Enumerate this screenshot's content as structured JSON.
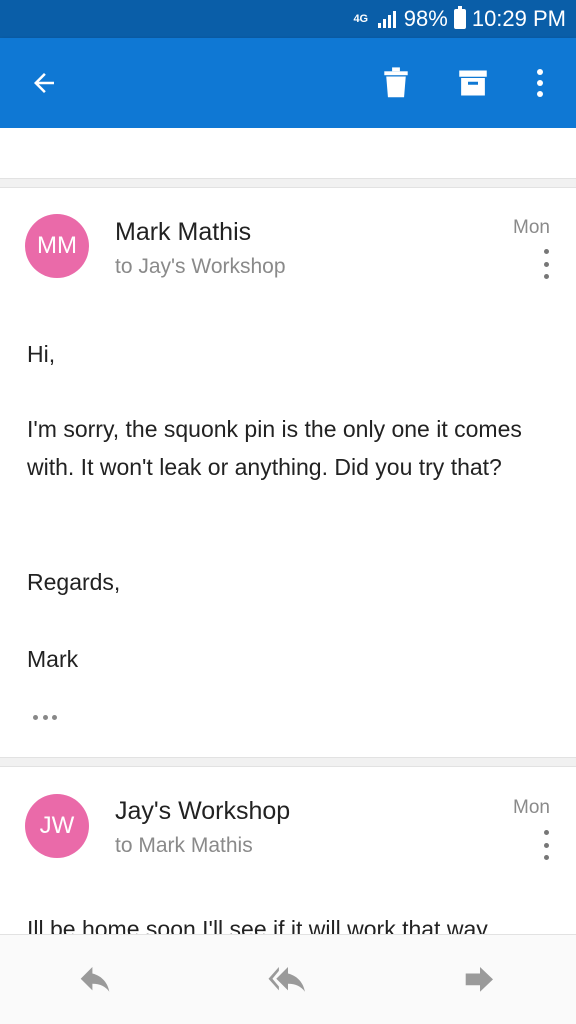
{
  "status_bar": {
    "network": "4G",
    "battery": "98%",
    "time": "10:29 PM"
  },
  "toolbar": {
    "back_icon": "arrow-left-icon",
    "delete_icon": "trash-icon",
    "archive_icon": "archive-icon",
    "more_icon": "more-vert-icon"
  },
  "messages": [
    {
      "initials": "MM",
      "sender": "Mark Mathis",
      "recipient": "to Jay's Workshop",
      "date": "Mon",
      "avatar_color": "#ea6aa9",
      "paragraphs": [
        "Hi,",
        "I'm sorry, the squonk pin is the only one it comes with. It won't leak or anything. Did you try that?",
        "Regards,",
        "Mark"
      ]
    },
    {
      "initials": "JW",
      "sender": "Jay's Workshop",
      "recipient": "to Mark Mathis",
      "date": "Mon",
      "avatar_color": "#ea6aa9",
      "preview": "Ill be home soon I'll see if it will work that way"
    }
  ],
  "bottom_bar": {
    "reply_icon": "reply-icon",
    "reply_all_icon": "reply-all-icon",
    "forward_icon": "forward-icon"
  },
  "colors": {
    "status_bar": "#0a5ea8",
    "app_bar": "#0f78d4",
    "avatar": "#ea6aa9"
  }
}
